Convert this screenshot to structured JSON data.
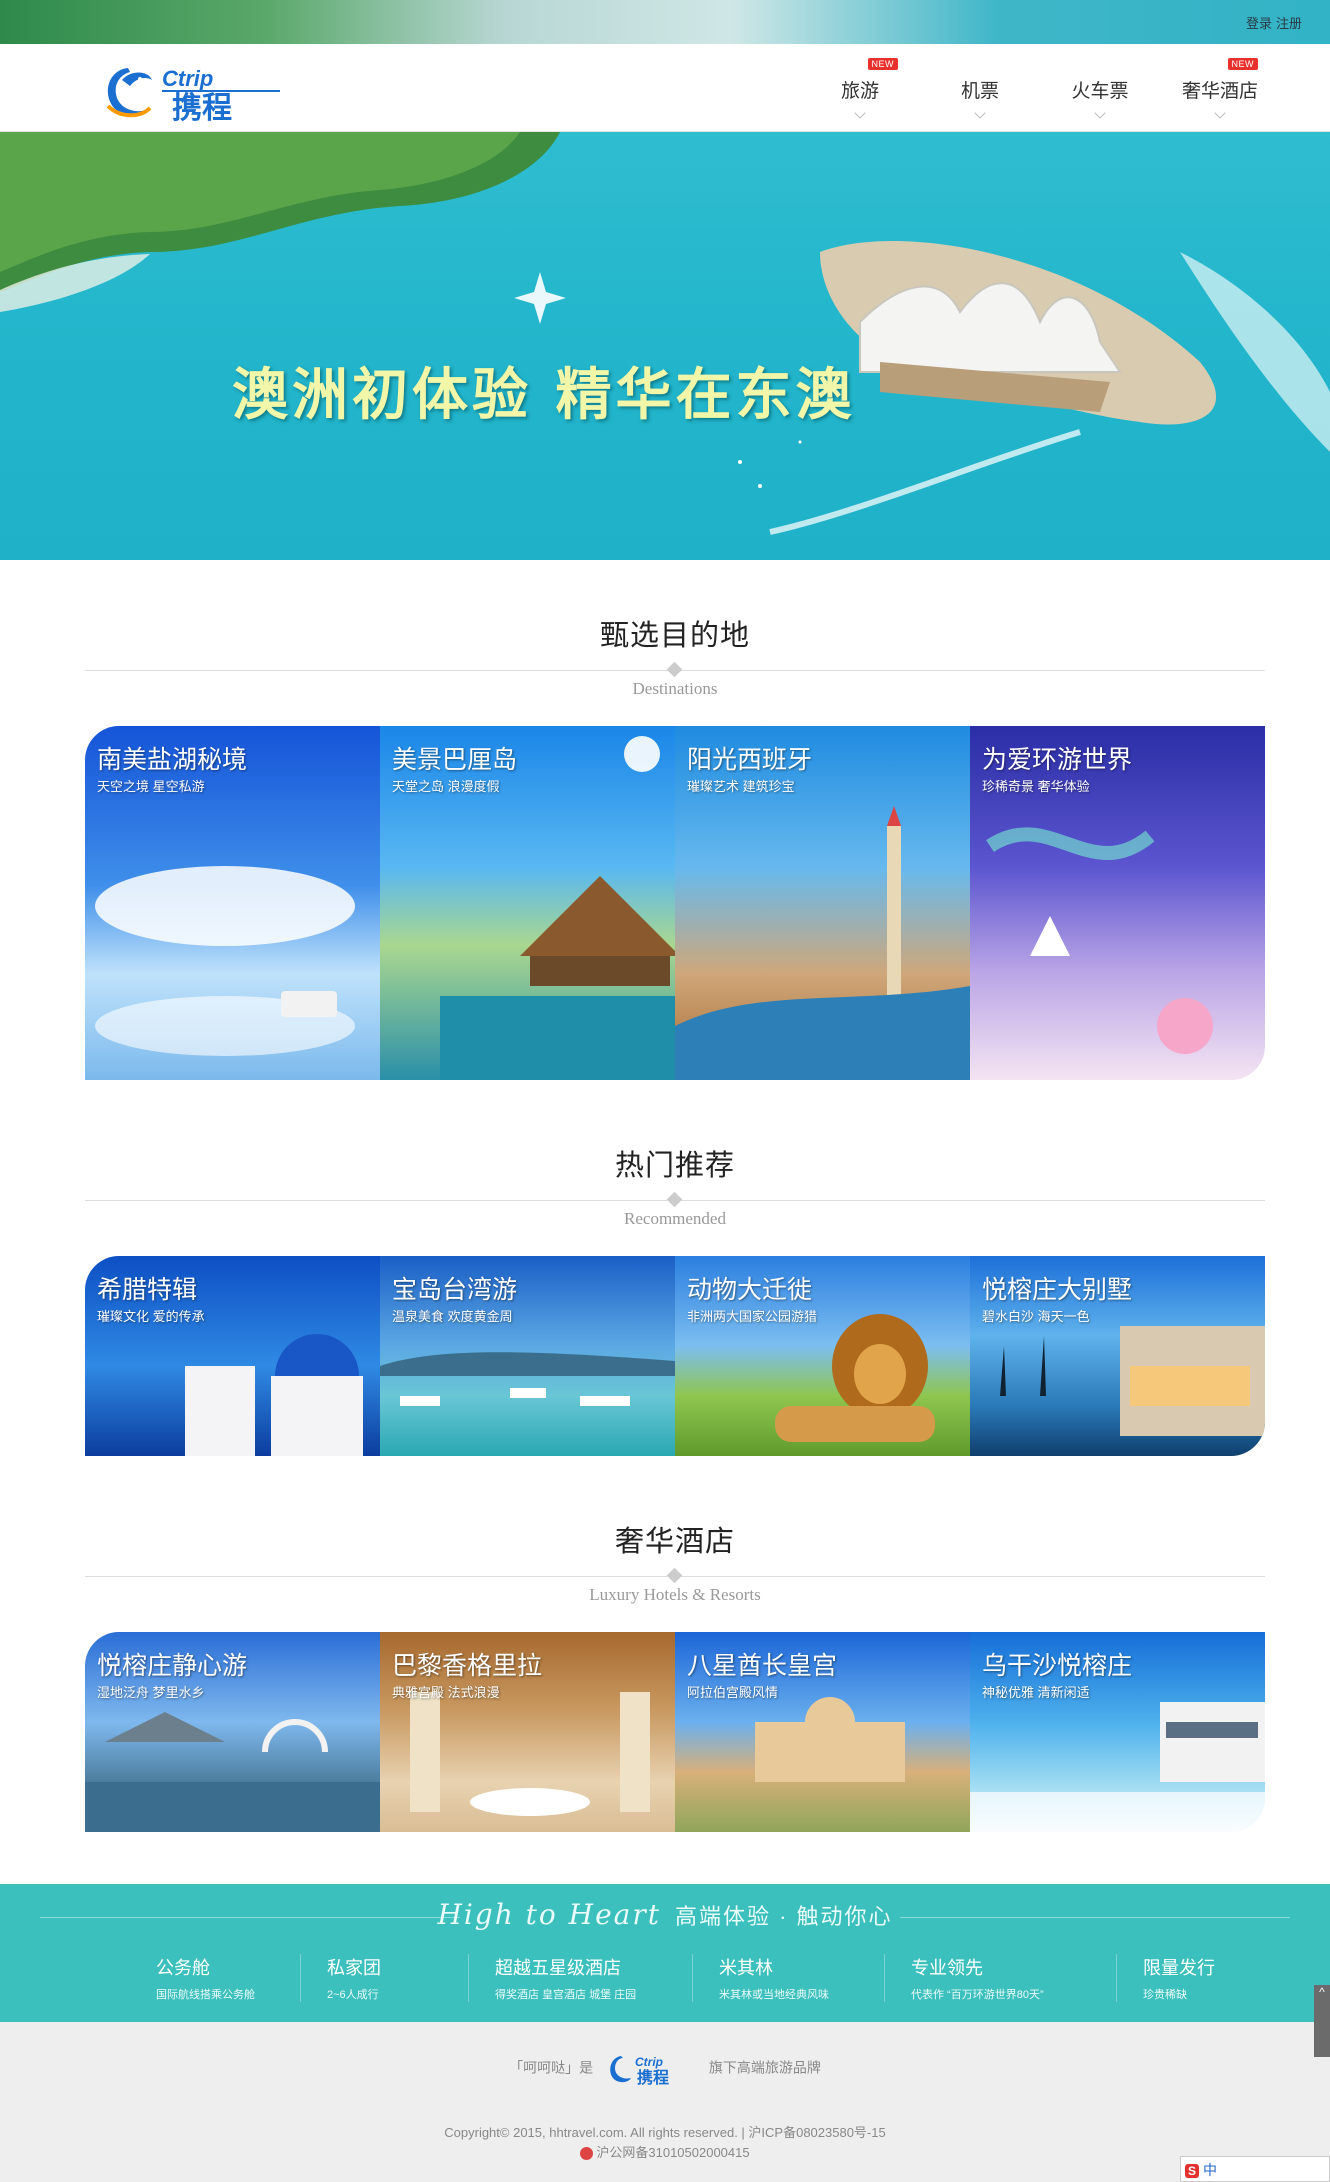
{
  "topbar": {
    "login": "登录",
    "register": "注册"
  },
  "header": {
    "logo_en": "Ctrip",
    "logo_cn": "携程",
    "nav": [
      {
        "label": "旅游",
        "badge": "NEW"
      },
      {
        "label": "机票",
        "badge": ""
      },
      {
        "label": "火车票",
        "badge": ""
      },
      {
        "label": "奢华酒店",
        "badge": "NEW"
      }
    ]
  },
  "banner": {
    "title": "澳洲初体验  精华在东澳"
  },
  "destinations": {
    "title": "甄选目的地",
    "subtitle": "Destinations",
    "cards": [
      {
        "title": "南美盐湖秘境",
        "sub": "天空之境 星空私游"
      },
      {
        "title": "美景巴厘岛",
        "sub": "天堂之岛 浪漫度假"
      },
      {
        "title": "阳光西班牙",
        "sub": "璀璨艺术 建筑珍宝"
      },
      {
        "title": "为爱环游世界",
        "sub": "珍稀奇景 奢华体验"
      }
    ]
  },
  "recommended": {
    "title": "热门推荐",
    "subtitle": "Recommended",
    "cards": [
      {
        "title": "希腊特辑",
        "sub": "璀璨文化 爱的传承"
      },
      {
        "title": "宝岛台湾游",
        "sub": "温泉美食 欢度黄金周"
      },
      {
        "title": "动物大迁徙",
        "sub": "非洲两大国家公园游猎"
      },
      {
        "title": "悦榕庄大别墅",
        "sub": "碧水白沙 海天一色"
      }
    ]
  },
  "hotels": {
    "title": "奢华酒店",
    "subtitle": "Luxury Hotels & Resorts",
    "cards": [
      {
        "title": "悦榕庄静心游",
        "sub": "湿地泛舟 梦里水乡"
      },
      {
        "title": "巴黎香格里拉",
        "sub": "典雅宫殿 法式浪漫"
      },
      {
        "title": "八星酋长皇宫",
        "sub": "阿拉伯宫殿风情"
      },
      {
        "title": "乌干沙悦榕庄",
        "sub": "神秘优雅 清新闲适"
      }
    ]
  },
  "band": {
    "slogan_en": "High to Heart",
    "slogan_cn": "高端体验 · 触动你心",
    "features": [
      {
        "title": "公务舱",
        "sub": "国际航线搭乘公务舱"
      },
      {
        "title": "私家团",
        "sub": "2~6人成行"
      },
      {
        "title": "超越五星级酒店",
        "sub": "得奖酒店 皇宫酒店 城堡 庄园"
      },
      {
        "title": "米其林",
        "sub": "米其林或当地经典风味"
      },
      {
        "title": "专业领先",
        "sub": "代表作 “百万环游世界80天”"
      },
      {
        "title": "限量发行",
        "sub": "珍贵稀缺"
      }
    ]
  },
  "footer": {
    "brand_pre": "「呵呵哒」是",
    "brand_post": "旗下高端旅游品牌",
    "copyright": "Copyright© 2015, hhtravel.com. All rights reserved. | 沪ICP备08023580号-15",
    "police": "沪公网备31010502000415"
  },
  "side_button": "^",
  "ime": {
    "logo": "S",
    "text": "中"
  }
}
